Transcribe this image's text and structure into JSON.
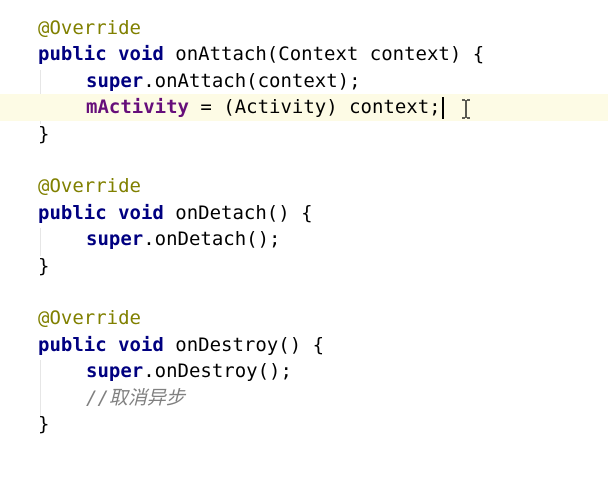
{
  "editor": {
    "lines": {
      "l1": {
        "annotation": "@Override"
      },
      "l2": {
        "mod": "public",
        "type": "void",
        "rest": " onAttach(Context context) {"
      },
      "l3": {
        "kw": "super",
        "rest": ".onAttach(context);"
      },
      "l4": {
        "field": "mActivity",
        "rest": " = (Activity) context;"
      },
      "l5": {
        "brace": "}"
      },
      "l7": {
        "annotation": "@Override"
      },
      "l8": {
        "mod": "public",
        "type": "void",
        "rest": " onDetach() {"
      },
      "l9": {
        "kw": "super",
        "rest": ".onDetach();"
      },
      "l10": {
        "brace": "}"
      },
      "l12": {
        "annotation": "@Override"
      },
      "l13": {
        "mod": "public",
        "type": "void",
        "rest": " onDestroy() {"
      },
      "l14": {
        "kw": "super",
        "rest": ".onDestroy();"
      },
      "l15": {
        "comment": "//取消异步"
      },
      "l16": {
        "brace": "}"
      }
    },
    "colors": {
      "annotation": "#808000",
      "keyword": "#000080",
      "field": "#660e7a",
      "comment": "#808080",
      "current_line": "#fdfbe5"
    },
    "cursor_icon": "text-cursor-ibeam-icon"
  }
}
